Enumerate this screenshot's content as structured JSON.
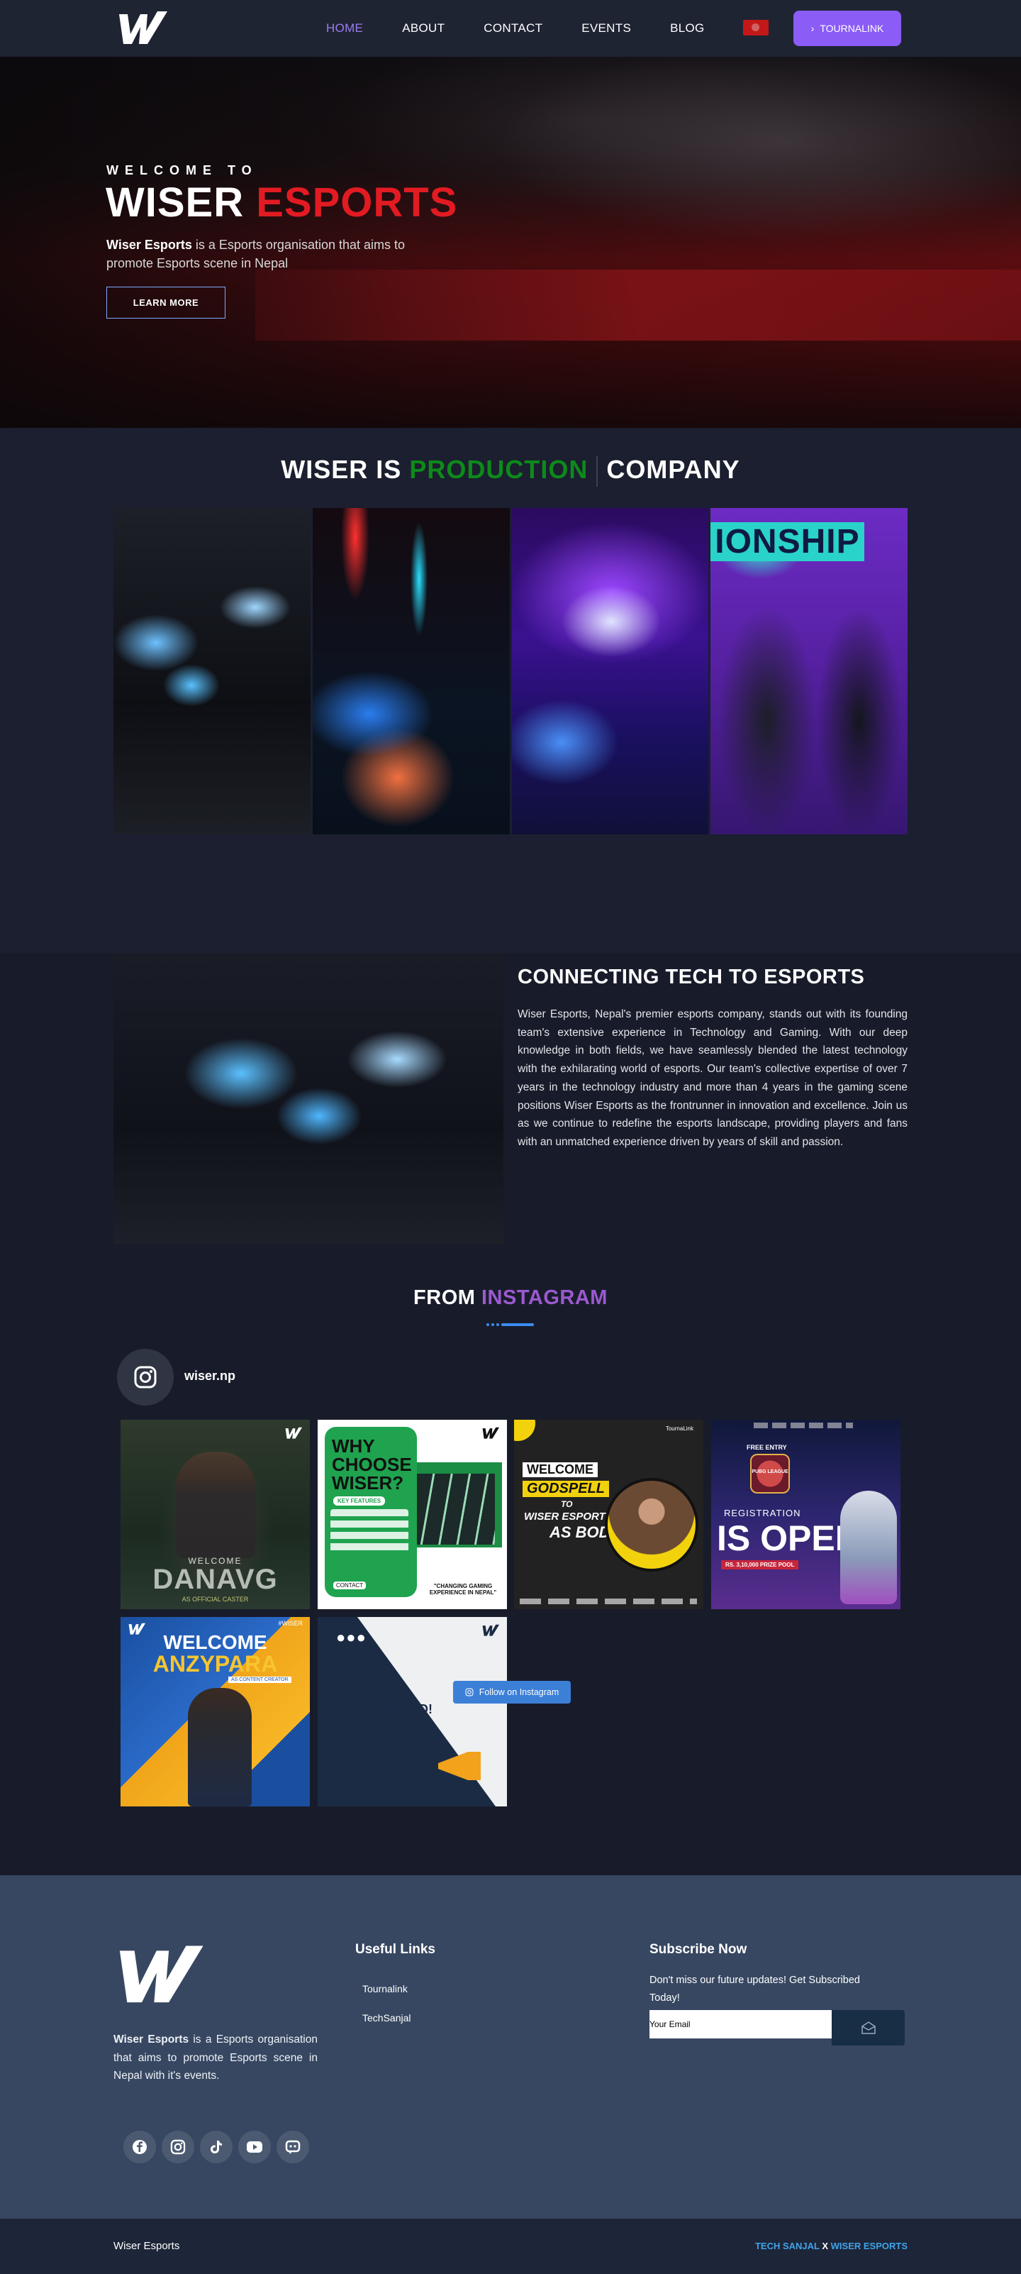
{
  "nav": {
    "items": [
      "HOME",
      "ABOUT",
      "CONTACT",
      "EVENTS",
      "BLOG"
    ],
    "cta_label": "TOURNALINK"
  },
  "hero": {
    "welcome": "WELCOME TO",
    "title_white": "WISER",
    "title_red": "ESPORTS",
    "desc_brand": "Wiser Esports",
    "desc_rest": " is a Esports  organisation that aims to promote Esports scene in Nepal",
    "button": "LEARN MORE"
  },
  "production": {
    "title_a": "WISER IS",
    "title_green": "PRODUCTION",
    "title_b": "COMPANY",
    "banner_text": "IONSHIP"
  },
  "connect": {
    "title": "CONNECTING TECH TO ESPORTS",
    "text": "Wiser Esports, Nepal's premier esports company, stands out with its founding team's extensive experience in Technology and Gaming. With our deep knowledge in both fields, we have seamlessly blended the latest technology with the exhilarating world of esports. Our team's collective expertise of over 7 years in the technology industry and more than 4 years in the gaming scene positions Wiser Esports as the frontrunner in innovation and excellence. Join us as we continue to redefine the esports landscape, providing players and fans with an unmatched experience driven by years of skill and passion."
  },
  "instagram": {
    "title_a": "FROM",
    "title_b": "INSTAGRAM",
    "handle": "wiser.np",
    "follow": "Follow on Instagram",
    "posts": {
      "p1_a": "WELCOME",
      "p1_b": "DANAVG",
      "p1_c": "AS OFFICIAL CASTER",
      "p2_a": "WHY",
      "p2_b": "CHOOSE",
      "p2_c": "WISER?",
      "p2_d": "KEY FEATURES",
      "p2_e": "CONTACT",
      "p2_f": "\"CHANGING GAMING EXPERIENCE IN NEPAL\"",
      "p3_a": "WELCOME",
      "p3_b": "GODSPELL",
      "p3_c": "TO",
      "p3_d": "WISER ESPORTS",
      "p3_e": "AS BOD!",
      "p3_f": "TournaLink",
      "p4_a": "FREE ENTRY",
      "p4_b": "REGISTRATION",
      "p4_c": "IS OPEN",
      "p4_d": "RS. 3,10,000 PRIZE POOL",
      "p4_e": "PUBG LEAGUE",
      "p5_a": "#WISER",
      "p5_b": "WELCOME",
      "p5_c": "ANZYPARA",
      "p5_d": "AS CONTENT CREATOR",
      "p6_a": "HELLO WORLD!"
    }
  },
  "footer": {
    "desc_brand": "Wiser Esports",
    "desc_rest": " is a Esports organisation that aims to promote Esports scene in Nepal with it's events.",
    "useful_title": "Useful Links",
    "links": [
      "Tournalink",
      "TechSanjal"
    ],
    "sub_title": "Subscribe Now",
    "sub_text": "Don't miss our future updates! Get Subscribed Today!",
    "email_placeholder": "Your Email",
    "socials": [
      "facebook-icon",
      "instagram-icon",
      "tiktok-icon",
      "youtube-icon",
      "discord-icon"
    ]
  },
  "bottom": {
    "left": "Wiser Esports",
    "right_a": "TECH SANJAL",
    "right_x": " X ",
    "right_b": "WISER ESPORTS"
  }
}
